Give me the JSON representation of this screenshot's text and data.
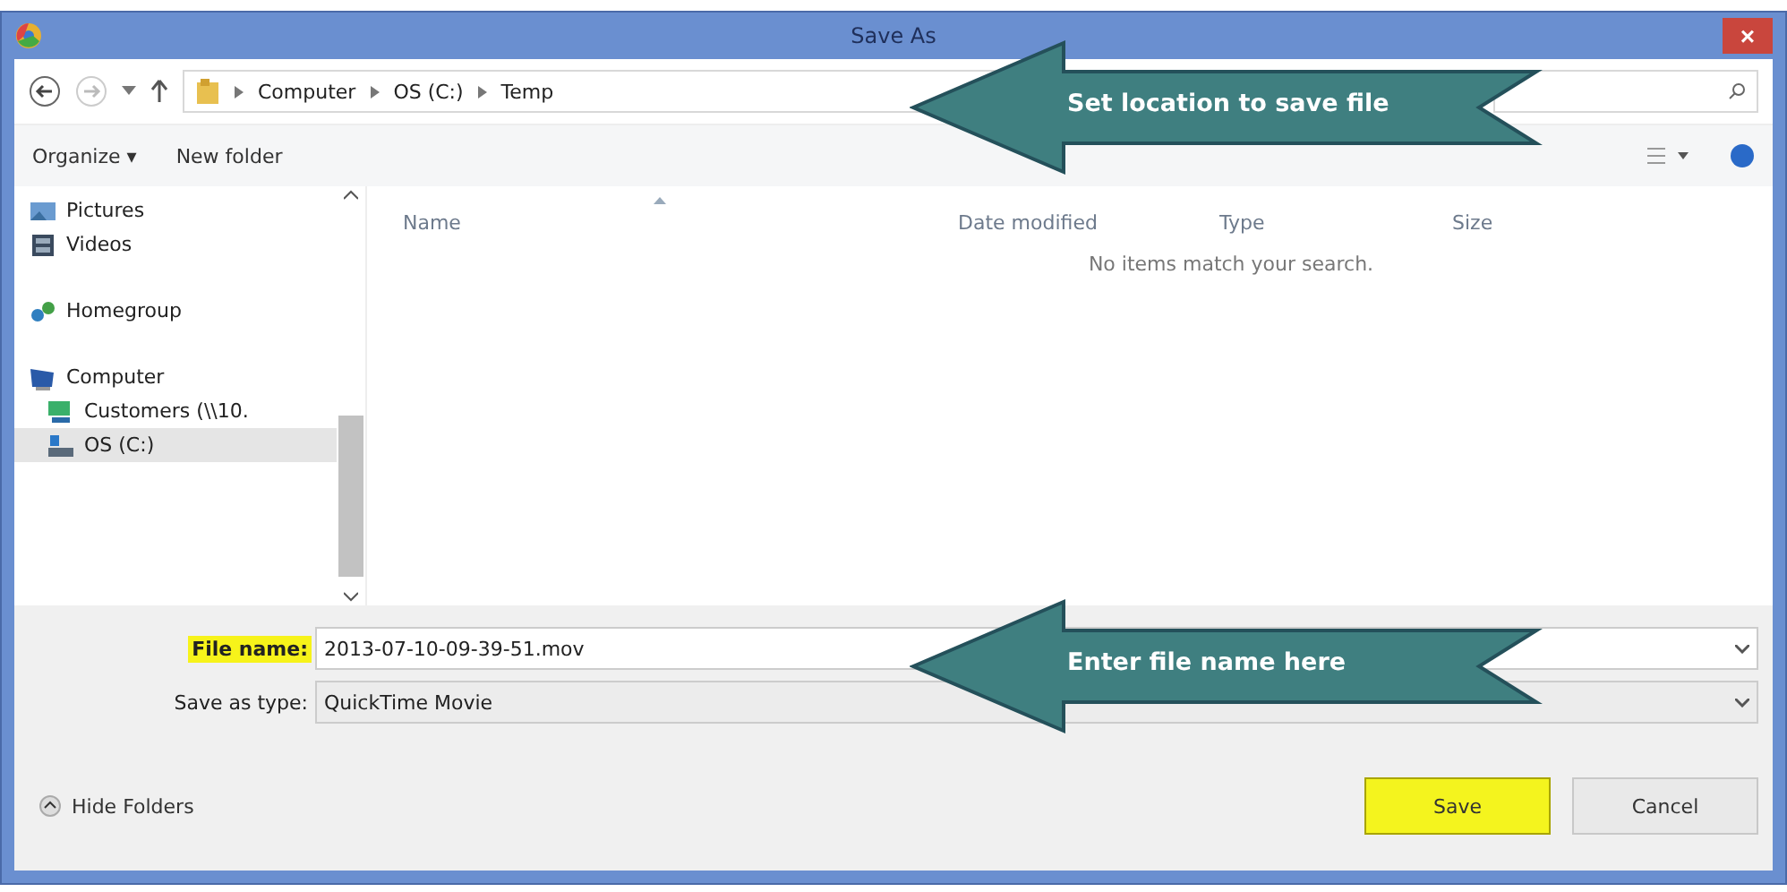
{
  "window": {
    "title": "Save As",
    "close": "×"
  },
  "address_bar": {
    "path": [
      "Computer",
      "OS (C:)",
      "Temp"
    ]
  },
  "toolbar": {
    "organize": "Organize ▾",
    "new_folder": "New folder"
  },
  "nav_pane": {
    "items": [
      {
        "label": "Pictures",
        "selected": false
      },
      {
        "label": "Videos",
        "selected": false
      },
      {
        "label": "Homegroup",
        "selected": false
      },
      {
        "label": "Computer",
        "selected": false,
        "children": [
          {
            "label": "Customers (\\\\10.",
            "selected": false
          },
          {
            "label": "OS (C:)",
            "selected": true
          }
        ]
      }
    ]
  },
  "file_list": {
    "columns": [
      "Name",
      "Date modified",
      "Type",
      "Size"
    ],
    "empty_message": "No items match your search."
  },
  "fields": [
    {
      "label": "File name:",
      "value": "2013-07-10-09-39-51.mov",
      "highlighted": true,
      "kind": "input"
    },
    {
      "label": "Save as type:",
      "value": "QuickTime Movie",
      "highlighted": false,
      "kind": "select"
    }
  ],
  "hide_folders": "Hide Folders",
  "buttons": [
    {
      "label": "Save",
      "highlighted": true
    },
    {
      "label": "Cancel",
      "highlighted": false
    }
  ],
  "callouts": [
    "Set location to save file",
    "Enter file name here"
  ]
}
